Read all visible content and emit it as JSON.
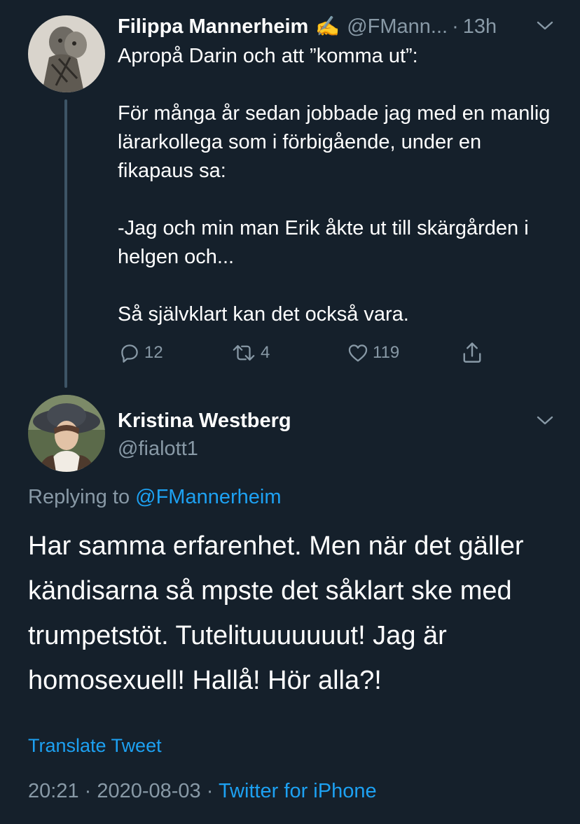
{
  "parent_tweet": {
    "author_name": "Filippa Mannerheim",
    "author_emoji": "✍️",
    "author_handle": "@FMann...",
    "separator": "·",
    "time_ago": "13h",
    "text_paragraphs": [
      "Apropå Darin och att ”komma ut”:",
      "",
      "För många år sedan jobbade jag med en manlig lärarkollega som i förbigående, under en fikapaus sa:",
      "",
      "-Jag och min man Erik åkte ut till skärgården i helgen och...",
      "",
      "Så självklart kan det också vara."
    ],
    "actions": {
      "reply_count": "12",
      "retweet_count": "4",
      "like_count": "119"
    },
    "icons": {
      "reply": "reply-icon",
      "retweet": "retweet-icon",
      "like": "heart-icon",
      "share": "share-icon",
      "menu": "chevron-down-icon"
    }
  },
  "reply_tweet": {
    "author_name": "Kristina Westberg",
    "author_handle": "@fialott1",
    "replying_prefix": "Replying to ",
    "replying_to": "@FMannerheim",
    "text": "Har samma erfarenhet. Men när det gäller kändisarna så mpste det såklart ske med trumpetstöt. Tutelituuuuuuut! Jag är homosexuell! Hallå! Hör alla?!",
    "translate_label": "Translate Tweet",
    "timestamp": "20:21 · 2020-08-03 · ",
    "source": "Twitter for iPhone"
  },
  "colors": {
    "background": "#15202b",
    "text": "#ffffff",
    "secondary": "#8899a6",
    "link": "#1da1f2",
    "thread_line": "#3d5466"
  }
}
